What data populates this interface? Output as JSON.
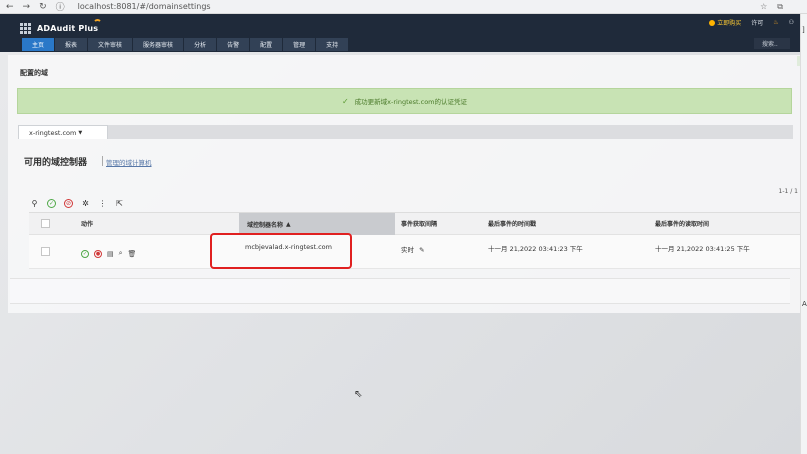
{
  "browser": {
    "back": "←",
    "forward": "→",
    "reload": "↻",
    "info": "ⓘ",
    "url": "localhost:8081/#/domainsettings"
  },
  "header": {
    "brand": "ADAudit Plus",
    "buy_label": "立即购买",
    "license_label": "许可",
    "tabs": [
      "主页",
      "报表",
      "文件审核",
      "服务器审核",
      "分析",
      "告警",
      "配置",
      "管理",
      "支持"
    ],
    "active_tab_index": 0,
    "search_placeholder": "搜索.."
  },
  "page": {
    "title": "配置的域",
    "success_message": "成功更新域x-ringtest.com的认证凭证",
    "domain_selector": "x-ringtest.com",
    "section_title": "可用的域控制器",
    "manage_link": "管理的域计算机",
    "pager": "1-1 / 1"
  },
  "table": {
    "columns": {
      "action": "动作",
      "dc_name": "域控制器名称",
      "interval": "事件获取间隔",
      "last_event_time": "最后事件的时间戳",
      "last_read_time": "最后事件的读取时间"
    },
    "rows": [
      {
        "dc_name": "mcbjevalad.x-ringtest.com",
        "interval": "实时",
        "last_event_time": "十一月 21,2022 03:41:23 下午",
        "last_read_time": "十一月 21,2022 03:41:25 下午"
      }
    ]
  },
  "colors": {
    "header_bg": "#1f2a3a",
    "active_tab": "#2a78c8",
    "success_bg": "#c8e3b4",
    "annotation": "#e02020"
  }
}
